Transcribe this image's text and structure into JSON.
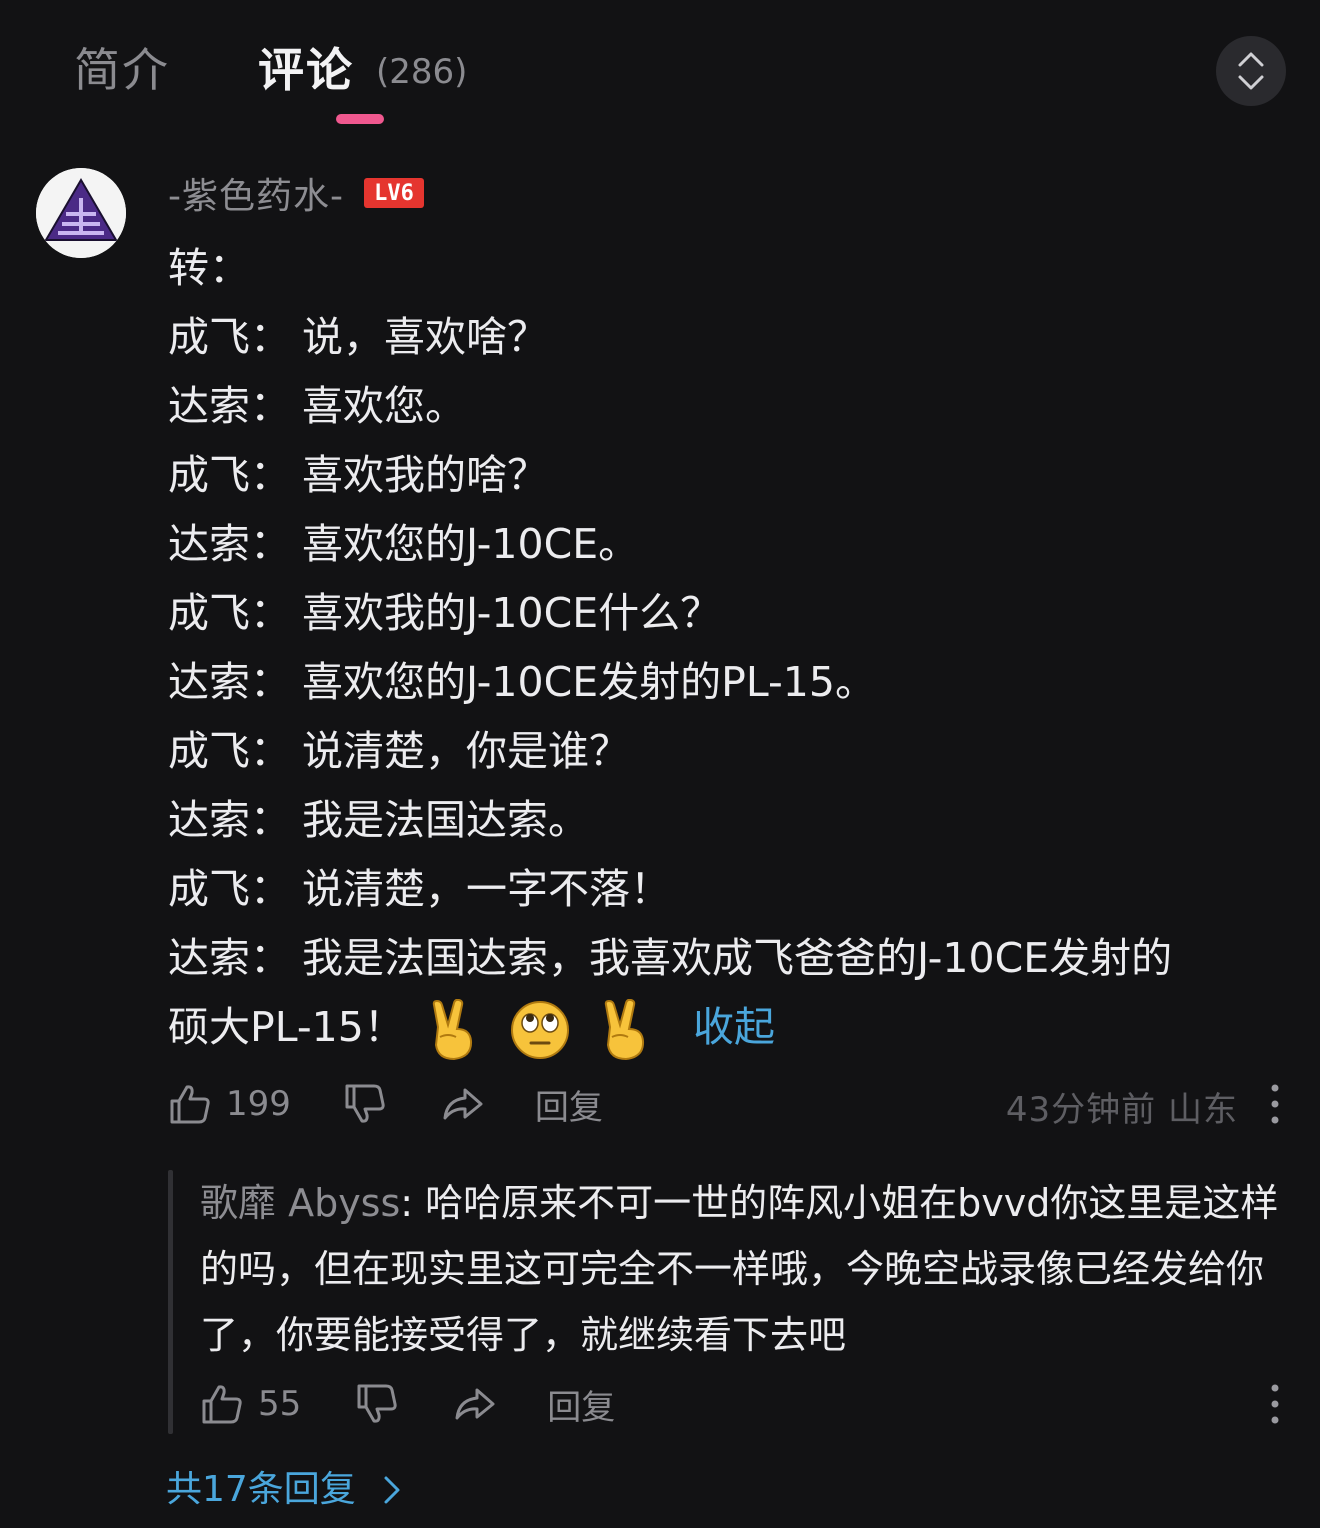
{
  "tabs": {
    "intro_label": "简介",
    "comments_label": "评论",
    "comments_count": "(286)"
  },
  "comment": {
    "username": "-紫色药水-",
    "level": "LV6",
    "lines": [
      {
        "speaker": "",
        "text": "转："
      },
      {
        "speaker": "成飞：",
        "text": "说，喜欢啥？"
      },
      {
        "speaker": "达索：",
        "text": "喜欢您。"
      },
      {
        "speaker": "成飞：",
        "text": "喜欢我的啥？"
      },
      {
        "speaker": "达索：",
        "text": "喜欢您的J-10CE。"
      },
      {
        "speaker": "成飞：",
        "text": "喜欢我的J-10CE什么？"
      },
      {
        "speaker": "达索：",
        "text": "喜欢您的J-10CE发射的PL-15。"
      },
      {
        "speaker": "成飞：",
        "text": "说清楚，你是谁？"
      },
      {
        "speaker": "达索：",
        "text": "我是法国达索。"
      },
      {
        "speaker": "成飞：",
        "text": "说清楚，一字不落！"
      },
      {
        "speaker": "达索：",
        "text": "我是法国达索，我喜欢成飞爸爸的J-10CE发射的"
      }
    ],
    "last_line": "硕大PL-15！",
    "collapse_label": "收起",
    "likes": "199",
    "reply_label": "回复",
    "time": "43分钟前",
    "location": "山东"
  },
  "reply": {
    "author": "歌靡 Abyss",
    "text": "哈哈原来不可一世的阵风小姐在bvvd你这里是这样的吗，但在现实里这可完全不一样哦，今晚空战录像已经发给你了，你要能接受得了，就继续看下去吧",
    "likes": "55",
    "reply_label": "回复"
  },
  "replies_link": {
    "label": "共17条回复"
  },
  "icons": {
    "scroll_toggle": "expand-collapse-icon",
    "like": "thumbs-up-icon",
    "dislike": "thumbs-down-icon",
    "share": "share-icon",
    "more": "more-vertical-icon",
    "chevron": "chevron-right-icon"
  },
  "colors": {
    "background": "#121214",
    "accent_pink": "#f0588f",
    "link_blue": "#4aa6dc",
    "level_badge": "#e5352f"
  }
}
